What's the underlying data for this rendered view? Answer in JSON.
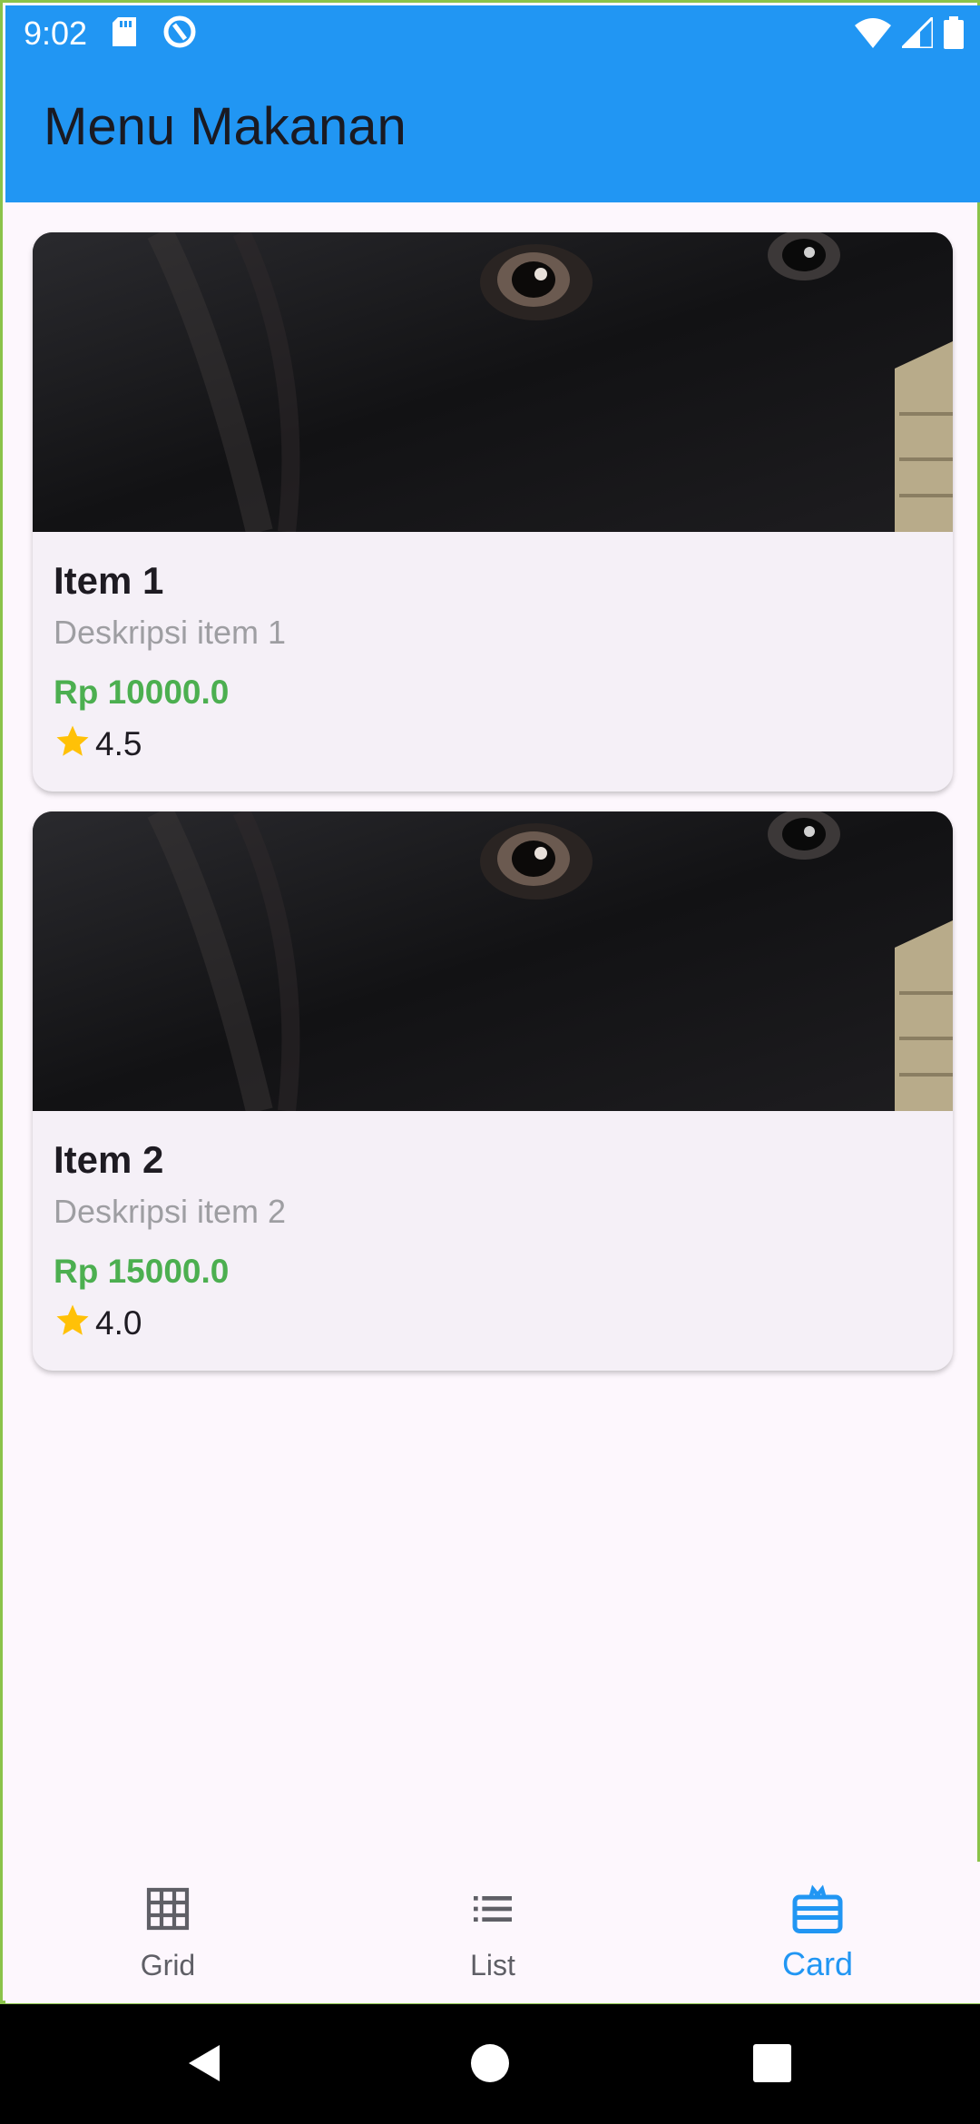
{
  "status_bar": {
    "time": "9:02",
    "left_icons": [
      "sd-card-icon",
      "data-saver-icon"
    ],
    "right_icons": [
      "wifi-icon",
      "signal-icon",
      "battery-icon"
    ],
    "background_color": "#2196f3"
  },
  "app_bar": {
    "title": "Menu Makanan",
    "background_color": "#2196f3"
  },
  "items": [
    {
      "title": "Item 1",
      "description": "Deskripsi item 1",
      "price": "Rp 10000.0",
      "rating": "4.5",
      "image_icon": "dog-photo"
    },
    {
      "title": "Item 2",
      "description": "Deskripsi item 2",
      "price": "Rp 15000.0",
      "rating": "4.0",
      "image_icon": "dog-photo"
    }
  ],
  "colors": {
    "price": "#4caf50",
    "star": "#ffc107",
    "accent": "#2196f3",
    "nav_inactive": "#5f5f66"
  },
  "bottom_nav": {
    "items": [
      {
        "label": "Grid",
        "icon": "grid-icon",
        "active": false
      },
      {
        "label": "List",
        "icon": "list-icon",
        "active": false
      },
      {
        "label": "Card",
        "icon": "card-icon",
        "active": true
      }
    ]
  },
  "system_nav": {
    "buttons": [
      "back-icon",
      "home-icon",
      "recents-icon"
    ]
  }
}
